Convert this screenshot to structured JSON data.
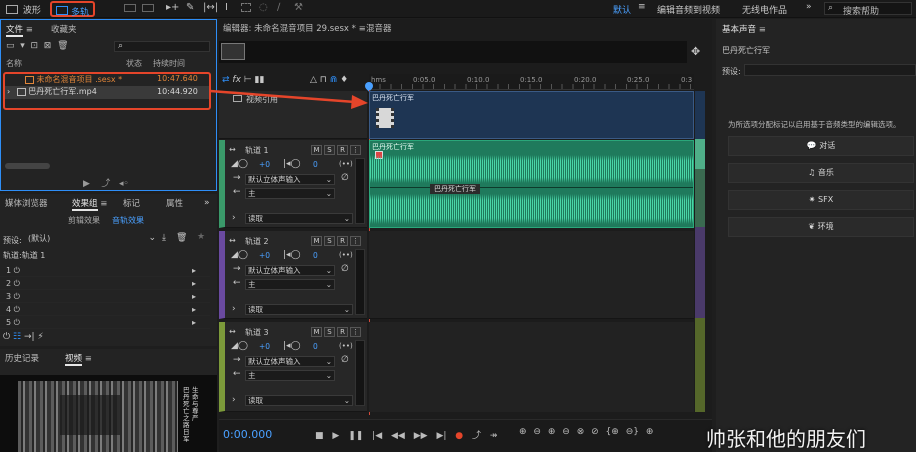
{
  "topbar": {
    "waveform_tab": "波形",
    "multitrack_tab": "多轨",
    "workspace_default": "默认",
    "workspace_edit_video": "编辑音频到视频",
    "workspace_radio": "无线电作品",
    "search_placeholder": "搜索帮助"
  },
  "files_panel": {
    "tab_files": "文件",
    "tab_favorites": "收藏夹",
    "col_name": "名称",
    "col_status": "状态",
    "col_duration": "持续时间",
    "items": [
      {
        "name": "未命名混音项目 .sesx *",
        "duration": "10:47.640"
      },
      {
        "name": "巴丹死亡行军.mp4",
        "duration": "10:44.920"
      }
    ]
  },
  "effects_panel": {
    "tab_media": "媒体浏览器",
    "tab_effects": "效果组",
    "tab_markers": "标记",
    "tab_properties": "属性",
    "subtab_clip": "剪辑效果",
    "subtab_track": "音轨效果",
    "preset_label": "预设:",
    "preset_value": "(默认)",
    "channel_label": "轨道:轨道 1",
    "slots": [
      "1",
      "2",
      "3",
      "4",
      "5"
    ]
  },
  "bottom_left": {
    "tab_history": "历史记录",
    "tab_video": "视频",
    "overlay_text_1": "生命与尊严",
    "overlay_text_2": "巴丹死亡之路日军"
  },
  "editor": {
    "tab_editor": "编辑器: 未命名混音项目 29.sesx *",
    "tab_mixer": "混音器",
    "ruler_unit": "hms",
    "ruler_ticks": [
      "0:05.0",
      "0:10.0",
      "0:15.0",
      "0:20.0",
      "0:25.0",
      "0:3"
    ],
    "video_track_label": "视频引用",
    "video_clip_label": "巴丹死亡行军",
    "audio_clip_label": "巴丹死亡行军",
    "audio_clip_center_label": "巴丹死亡行军",
    "timecode": "0:00.000",
    "tracks": [
      {
        "name": "轨道 1",
        "volume": "+0",
        "pan": "0",
        "input": "默认立体声输入",
        "output": "主",
        "mode": "读取"
      },
      {
        "name": "轨道 2",
        "volume": "+0",
        "pan": "0",
        "input": "默认立体声输入",
        "output": "主",
        "mode": "读取"
      },
      {
        "name": "轨道 3",
        "volume": "+0",
        "pan": "0",
        "input": "默认立体声输入",
        "output": "主",
        "mode": "读取"
      }
    ]
  },
  "essential_sound": {
    "title": "基本声音",
    "clip_name": "巴丹死亡行军",
    "preset_label": "预设:",
    "hint": "为所选项分配标记以启用基于音频类型的编辑选项。",
    "buttons": [
      "对话",
      "音乐",
      "SFX",
      "环境"
    ]
  },
  "watermark": "帅张和他的朋友们",
  "colors": {
    "accent": "#2e8ef7",
    "annotation": "#e5452a",
    "audio_clip": "#1f7a5c",
    "waveform": "#4fe0b0",
    "video_clip": "#1e3553",
    "track1": "#3a9a6a",
    "track2": "#6a4aa0",
    "track3": "#7c9a3a"
  }
}
